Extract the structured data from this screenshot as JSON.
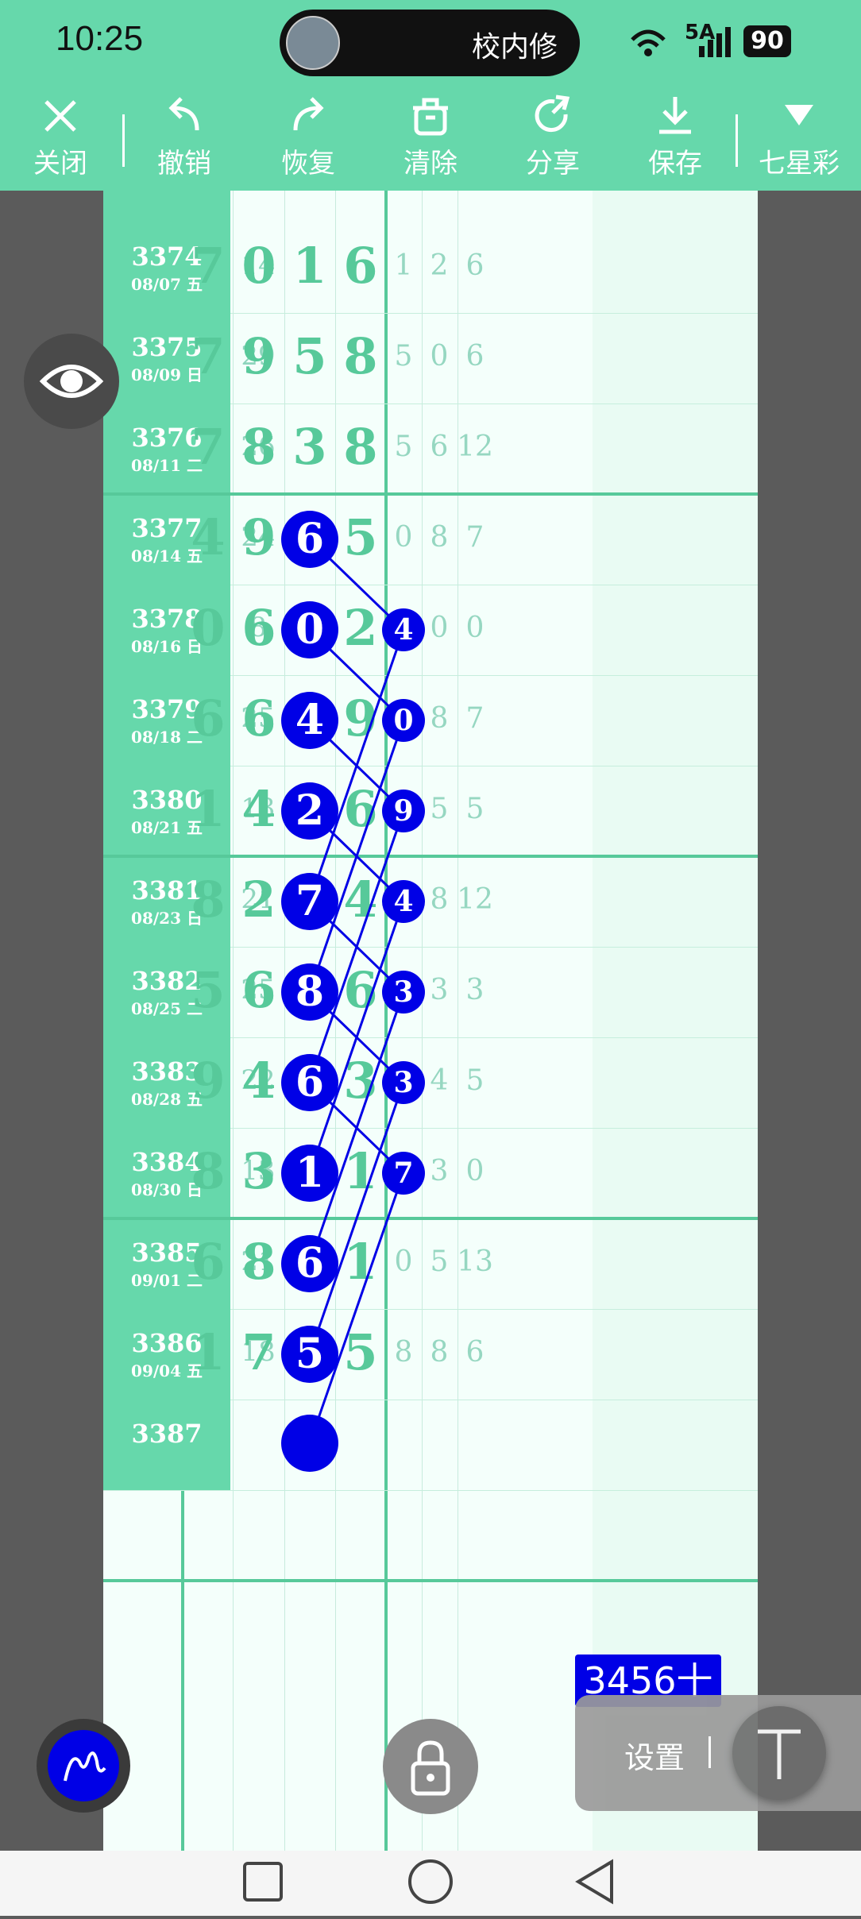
{
  "status_bar": {
    "time": "10:25",
    "notification_text": "校内修",
    "network": "5A",
    "battery": "90"
  },
  "toolbar": {
    "close": "关闭",
    "undo": "撤销",
    "redo": "恢复",
    "clear": "清除",
    "share": "分享",
    "save": "保存",
    "lottery": "七星彩"
  },
  "rows": [
    {
      "issue": "3374",
      "date": "08/07 五",
      "sum": "14",
      "d": [
        "7",
        "0",
        "1",
        "6"
      ],
      "s": [
        "1",
        "2",
        "6"
      ]
    },
    {
      "issue": "3375",
      "date": "08/09 日",
      "sum": "29",
      "d": [
        "7",
        "9",
        "5",
        "8"
      ],
      "s": [
        "5",
        "0",
        "6"
      ]
    },
    {
      "issue": "3376",
      "date": "08/11 二",
      "sum": "26",
      "d": [
        "7",
        "8",
        "3",
        "8"
      ],
      "s": [
        "5",
        "6",
        "12"
      ]
    },
    {
      "issue": "3377",
      "date": "08/14 五",
      "sum": "24",
      "d": [
        "4",
        "9",
        "6",
        "5"
      ],
      "s": [
        "0",
        "8",
        "7"
      ]
    },
    {
      "issue": "3378",
      "date": "08/16 日",
      "sum": "8",
      "d": [
        "0",
        "6",
        "0",
        "2"
      ],
      "s": [
        "4",
        "0",
        "0"
      ]
    },
    {
      "issue": "3379",
      "date": "08/18 二",
      "sum": "25",
      "d": [
        "6",
        "6",
        "4",
        "9"
      ],
      "s": [
        "0",
        "8",
        "7"
      ]
    },
    {
      "issue": "3380",
      "date": "08/21 五",
      "sum": "13",
      "d": [
        "1",
        "4",
        "2",
        "6"
      ],
      "s": [
        "9",
        "5",
        "5"
      ]
    },
    {
      "issue": "3381",
      "date": "08/23 日",
      "sum": "21",
      "d": [
        "8",
        "2",
        "7",
        "4"
      ],
      "s": [
        "4",
        "8",
        "12"
      ]
    },
    {
      "issue": "3382",
      "date": "08/25 二",
      "sum": "25",
      "d": [
        "5",
        "6",
        "8",
        "6"
      ],
      "s": [
        "3",
        "3",
        "3"
      ]
    },
    {
      "issue": "3383",
      "date": "08/28 五",
      "sum": "22",
      "d": [
        "9",
        "4",
        "6",
        "3"
      ],
      "s": [
        "3",
        "4",
        "5"
      ]
    },
    {
      "issue": "3384",
      "date": "08/30 日",
      "sum": "13",
      "d": [
        "8",
        "3",
        "1",
        "1"
      ],
      "s": [
        "7",
        "3",
        "0"
      ]
    },
    {
      "issue": "3385",
      "date": "09/01 二",
      "sum": "21",
      "d": [
        "6",
        "8",
        "6",
        "1"
      ],
      "s": [
        "0",
        "5",
        "13"
      ]
    },
    {
      "issue": "3386",
      "date": "09/04 五",
      "sum": "18",
      "d": [
        "1",
        "7",
        "5",
        "5"
      ],
      "s": [
        "8",
        "8",
        "6"
      ]
    },
    {
      "issue": "3387",
      "date": "",
      "sum": "",
      "d": [
        "",
        "",
        "",
        ""
      ],
      "s": [
        "",
        "",
        ""
      ]
    }
  ],
  "highlight_col3": [
    "6",
    "0",
    "4",
    "2",
    "7",
    "8",
    "6",
    "1",
    "6",
    "5"
  ],
  "highlight_col5": [
    "4",
    "0",
    "9",
    "4",
    "3",
    "3",
    "7"
  ],
  "prediction_tag": "3456十",
  "settings_label": "设置",
  "colors": {
    "accent": "#66d8ab",
    "marker": "#0000e6"
  }
}
